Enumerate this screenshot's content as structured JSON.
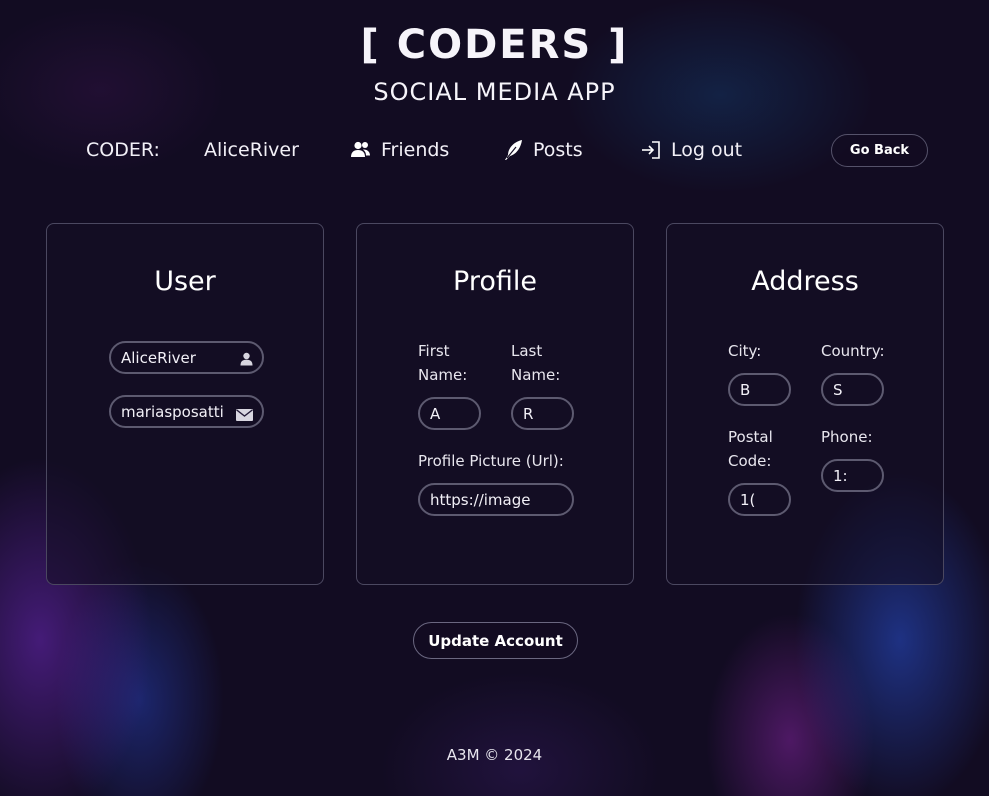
{
  "header": {
    "title": "[ CODERS ]",
    "subtitle": "SOCIAL MEDIA APP"
  },
  "nav": {
    "coder_label": "CODER:",
    "username": "AliceRiver",
    "friends_label": "Friends",
    "posts_label": "Posts",
    "logout_label": "Log out",
    "go_back_label": "Go Back"
  },
  "user_card": {
    "title": "User",
    "username_value": "AliceRiver",
    "email_value": "mariasposatti"
  },
  "profile_card": {
    "title": "Profile",
    "first_name_label": "First Name:",
    "first_name_value": "A",
    "last_name_label": "Last Name:",
    "last_name_value": "R",
    "picture_label": "Profile Picture (Url):",
    "picture_value": "https://image"
  },
  "address_card": {
    "title": "Address",
    "city_label": "City:",
    "city_value": "B",
    "country_label": "Country:",
    "country_value": "S",
    "postal_label": "Postal Code:",
    "postal_value": "1(",
    "phone_label": "Phone:",
    "phone_value": "1:"
  },
  "update_button_label": "Update Account",
  "footer": "A3M © 2024",
  "icons": {
    "friends": "users-icon",
    "posts": "feather-icon",
    "logout": "sign-in-icon",
    "username": "user-icon",
    "email": "envelope-icon"
  }
}
